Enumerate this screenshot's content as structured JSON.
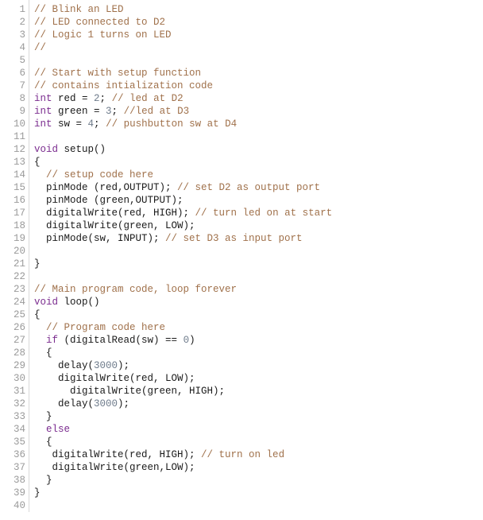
{
  "editor": {
    "name": "code-editor",
    "language": "arduino-c",
    "background_color": "#ffffff",
    "gutter_color": "#9a9a9a",
    "gutter_divider_color": "#d8d8d8",
    "total_lines": 40
  },
  "colors": {
    "comment": "#A0714B",
    "keyword": "#7B2C8F",
    "number": "#6E7B8B",
    "plain": "#1a1a1a"
  },
  "gutter": {
    "line_numbers": [
      "1",
      "2",
      "3",
      "4",
      "5",
      "6",
      "7",
      "8",
      "9",
      "10",
      "11",
      "12",
      "13",
      "14",
      "15",
      "16",
      "17",
      "18",
      "19",
      "20",
      "21",
      "22",
      "23",
      "24",
      "25",
      "26",
      "27",
      "28",
      "29",
      "30",
      "31",
      "32",
      "33",
      "34",
      "35",
      "36",
      "37",
      "38",
      "39",
      "40"
    ]
  },
  "code": {
    "lines": [
      {
        "n": 1,
        "text": "// Blink an LED",
        "tokens": [
          {
            "t": "// Blink an LED",
            "c": "comment"
          }
        ]
      },
      {
        "n": 2,
        "text": "// LED connected to D2",
        "tokens": [
          {
            "t": "// LED connected to D2",
            "c": "comment"
          }
        ]
      },
      {
        "n": 3,
        "text": "// Logic 1 turns on LED",
        "tokens": [
          {
            "t": "// Logic 1 turns on LED",
            "c": "comment"
          }
        ]
      },
      {
        "n": 4,
        "text": "//",
        "tokens": [
          {
            "t": "//",
            "c": "comment"
          }
        ]
      },
      {
        "n": 5,
        "text": "",
        "tokens": []
      },
      {
        "n": 6,
        "text": "// Start with setup function",
        "tokens": [
          {
            "t": "// Start with setup function",
            "c": "comment"
          }
        ]
      },
      {
        "n": 7,
        "text": "// contains intialization code",
        "tokens": [
          {
            "t": "// contains intialization code",
            "c": "comment"
          }
        ]
      },
      {
        "n": 8,
        "text": "int red = 2; // led at D2",
        "tokens": [
          {
            "t": "int",
            "c": "keyword"
          },
          {
            "t": " red = ",
            "c": "plain"
          },
          {
            "t": "2",
            "c": "number"
          },
          {
            "t": "; ",
            "c": "plain"
          },
          {
            "t": "// led at D2",
            "c": "comment"
          }
        ]
      },
      {
        "n": 9,
        "text": "int green = 3; //led at D3",
        "tokens": [
          {
            "t": "int",
            "c": "keyword"
          },
          {
            "t": " green = ",
            "c": "plain"
          },
          {
            "t": "3",
            "c": "number"
          },
          {
            "t": "; ",
            "c": "plain"
          },
          {
            "t": "//led at D3",
            "c": "comment"
          }
        ]
      },
      {
        "n": 10,
        "text": "int sw = 4; // pushbutton sw at D4",
        "tokens": [
          {
            "t": "int",
            "c": "keyword"
          },
          {
            "t": " sw = ",
            "c": "plain"
          },
          {
            "t": "4",
            "c": "number"
          },
          {
            "t": "; ",
            "c": "plain"
          },
          {
            "t": "// pushbutton sw at D4",
            "c": "comment"
          }
        ]
      },
      {
        "n": 11,
        "text": "",
        "tokens": []
      },
      {
        "n": 12,
        "text": "void setup()",
        "tokens": [
          {
            "t": "void",
            "c": "keyword"
          },
          {
            "t": " setup()",
            "c": "plain"
          }
        ]
      },
      {
        "n": 13,
        "text": "{",
        "tokens": [
          {
            "t": "{",
            "c": "plain"
          }
        ]
      },
      {
        "n": 14,
        "text": "  // setup code here",
        "tokens": [
          {
            "t": "  ",
            "c": "plain"
          },
          {
            "t": "// setup code here",
            "c": "comment"
          }
        ]
      },
      {
        "n": 15,
        "text": "  pinMode (red,OUTPUT); // set D2 as output port",
        "tokens": [
          {
            "t": "  pinMode (red,OUTPUT); ",
            "c": "plain"
          },
          {
            "t": "// set D2 as output port",
            "c": "comment"
          }
        ]
      },
      {
        "n": 16,
        "text": "  pinMode (green,OUTPUT);",
        "tokens": [
          {
            "t": "  pinMode (green,OUTPUT);",
            "c": "plain"
          }
        ]
      },
      {
        "n": 17,
        "text": "  digitalWrite(red, HIGH); // turn led on at start",
        "tokens": [
          {
            "t": "  digitalWrite(red, HIGH); ",
            "c": "plain"
          },
          {
            "t": "// turn led on at start",
            "c": "comment"
          }
        ]
      },
      {
        "n": 18,
        "text": "  digitalWrite(green, LOW);",
        "tokens": [
          {
            "t": "  digitalWrite(green, LOW);",
            "c": "plain"
          }
        ]
      },
      {
        "n": 19,
        "text": "  pinMode(sw, INPUT); // set D3 as input port",
        "tokens": [
          {
            "t": "  pinMode(sw, INPUT); ",
            "c": "plain"
          },
          {
            "t": "// set D3 as input port",
            "c": "comment"
          }
        ]
      },
      {
        "n": 20,
        "text": "",
        "tokens": []
      },
      {
        "n": 21,
        "text": "}",
        "tokens": [
          {
            "t": "}",
            "c": "plain"
          }
        ]
      },
      {
        "n": 22,
        "text": "",
        "tokens": []
      },
      {
        "n": 23,
        "text": "// Main program code, loop forever",
        "tokens": [
          {
            "t": "// Main program code, loop forever",
            "c": "comment"
          }
        ]
      },
      {
        "n": 24,
        "text": "void loop()",
        "tokens": [
          {
            "t": "void",
            "c": "keyword"
          },
          {
            "t": " loop()",
            "c": "plain"
          }
        ]
      },
      {
        "n": 25,
        "text": "{",
        "tokens": [
          {
            "t": "{",
            "c": "plain"
          }
        ]
      },
      {
        "n": 26,
        "text": "  // Program code here",
        "tokens": [
          {
            "t": "  ",
            "c": "plain"
          },
          {
            "t": "// Program code here",
            "c": "comment"
          }
        ]
      },
      {
        "n": 27,
        "text": "  if (digitalRead(sw) == 0)",
        "tokens": [
          {
            "t": "  ",
            "c": "plain"
          },
          {
            "t": "if",
            "c": "keyword"
          },
          {
            "t": " (digitalRead(sw) == ",
            "c": "plain"
          },
          {
            "t": "0",
            "c": "number"
          },
          {
            "t": ")",
            "c": "plain"
          }
        ]
      },
      {
        "n": 28,
        "text": "  {",
        "tokens": [
          {
            "t": "  {",
            "c": "plain"
          }
        ]
      },
      {
        "n": 29,
        "text": "    delay(3000);",
        "tokens": [
          {
            "t": "    delay(",
            "c": "plain"
          },
          {
            "t": "3000",
            "c": "number"
          },
          {
            "t": ");",
            "c": "plain"
          }
        ]
      },
      {
        "n": 30,
        "text": "    digitalWrite(red, LOW);",
        "tokens": [
          {
            "t": "    digitalWrite(red, LOW);",
            "c": "plain"
          }
        ]
      },
      {
        "n": 31,
        "text": "      digitalWrite(green, HIGH);",
        "tokens": [
          {
            "t": "      digitalWrite(green, HIGH);",
            "c": "plain"
          }
        ]
      },
      {
        "n": 32,
        "text": "    delay(3000);",
        "tokens": [
          {
            "t": "    delay(",
            "c": "plain"
          },
          {
            "t": "3000",
            "c": "number"
          },
          {
            "t": ");",
            "c": "plain"
          }
        ]
      },
      {
        "n": 33,
        "text": "  }",
        "tokens": [
          {
            "t": "  }",
            "c": "plain"
          }
        ]
      },
      {
        "n": 34,
        "text": "  else",
        "tokens": [
          {
            "t": "  ",
            "c": "plain"
          },
          {
            "t": "else",
            "c": "keyword"
          }
        ]
      },
      {
        "n": 35,
        "text": "  {",
        "tokens": [
          {
            "t": "  {",
            "c": "plain"
          }
        ]
      },
      {
        "n": 36,
        "text": "   digitalWrite(red, HIGH); // turn on led",
        "tokens": [
          {
            "t": "   digitalWrite(red, HIGH); ",
            "c": "plain"
          },
          {
            "t": "// turn on led",
            "c": "comment"
          }
        ]
      },
      {
        "n": 37,
        "text": "   digitalWrite(green,LOW);",
        "tokens": [
          {
            "t": "   digitalWrite(green,LOW);",
            "c": "plain"
          }
        ]
      },
      {
        "n": 38,
        "text": "  }",
        "tokens": [
          {
            "t": "  }",
            "c": "plain"
          }
        ]
      },
      {
        "n": 39,
        "text": "}",
        "tokens": [
          {
            "t": "}",
            "c": "plain"
          }
        ]
      },
      {
        "n": 40,
        "text": "",
        "tokens": []
      }
    ]
  }
}
